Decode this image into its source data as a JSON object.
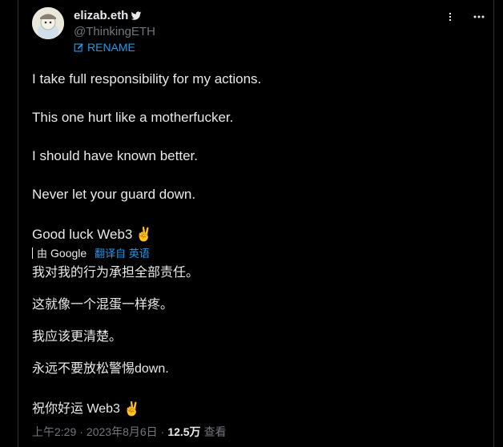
{
  "author": {
    "name": "elizab.eth",
    "handle": "@ThinkingETH",
    "rename_label": "RENAME"
  },
  "tweet": {
    "lines": [
      "I take full responsibility for my actions.",
      "This one hurt like a motherfucker.",
      "I should have known better.",
      "Never let your guard down.",
      "Good luck Web3"
    ],
    "emoji": "✌️"
  },
  "translation": {
    "by": "由",
    "provider": "Google",
    "action": "翻译自 英语",
    "lines": [
      "我对我的行为承担全部责任。",
      "这就像一个混蛋一样疼。",
      "我应该更清楚。",
      "永远不要放松警惕down.",
      "祝你好运 Web3"
    ]
  },
  "meta": {
    "time": "上午2:29",
    "sep1": "·",
    "date": "2023年8月6日",
    "sep2": "·",
    "views": "12.5万",
    "views_label": "查看"
  },
  "icons": {
    "verified": "bird-icon",
    "rename": "edit-icon",
    "top": [
      "share-icon",
      "more-icon"
    ]
  },
  "colors": {
    "background": "#000000",
    "text": "#e7e9ea",
    "muted": "#71767b",
    "link": "#1d9bf0"
  }
}
